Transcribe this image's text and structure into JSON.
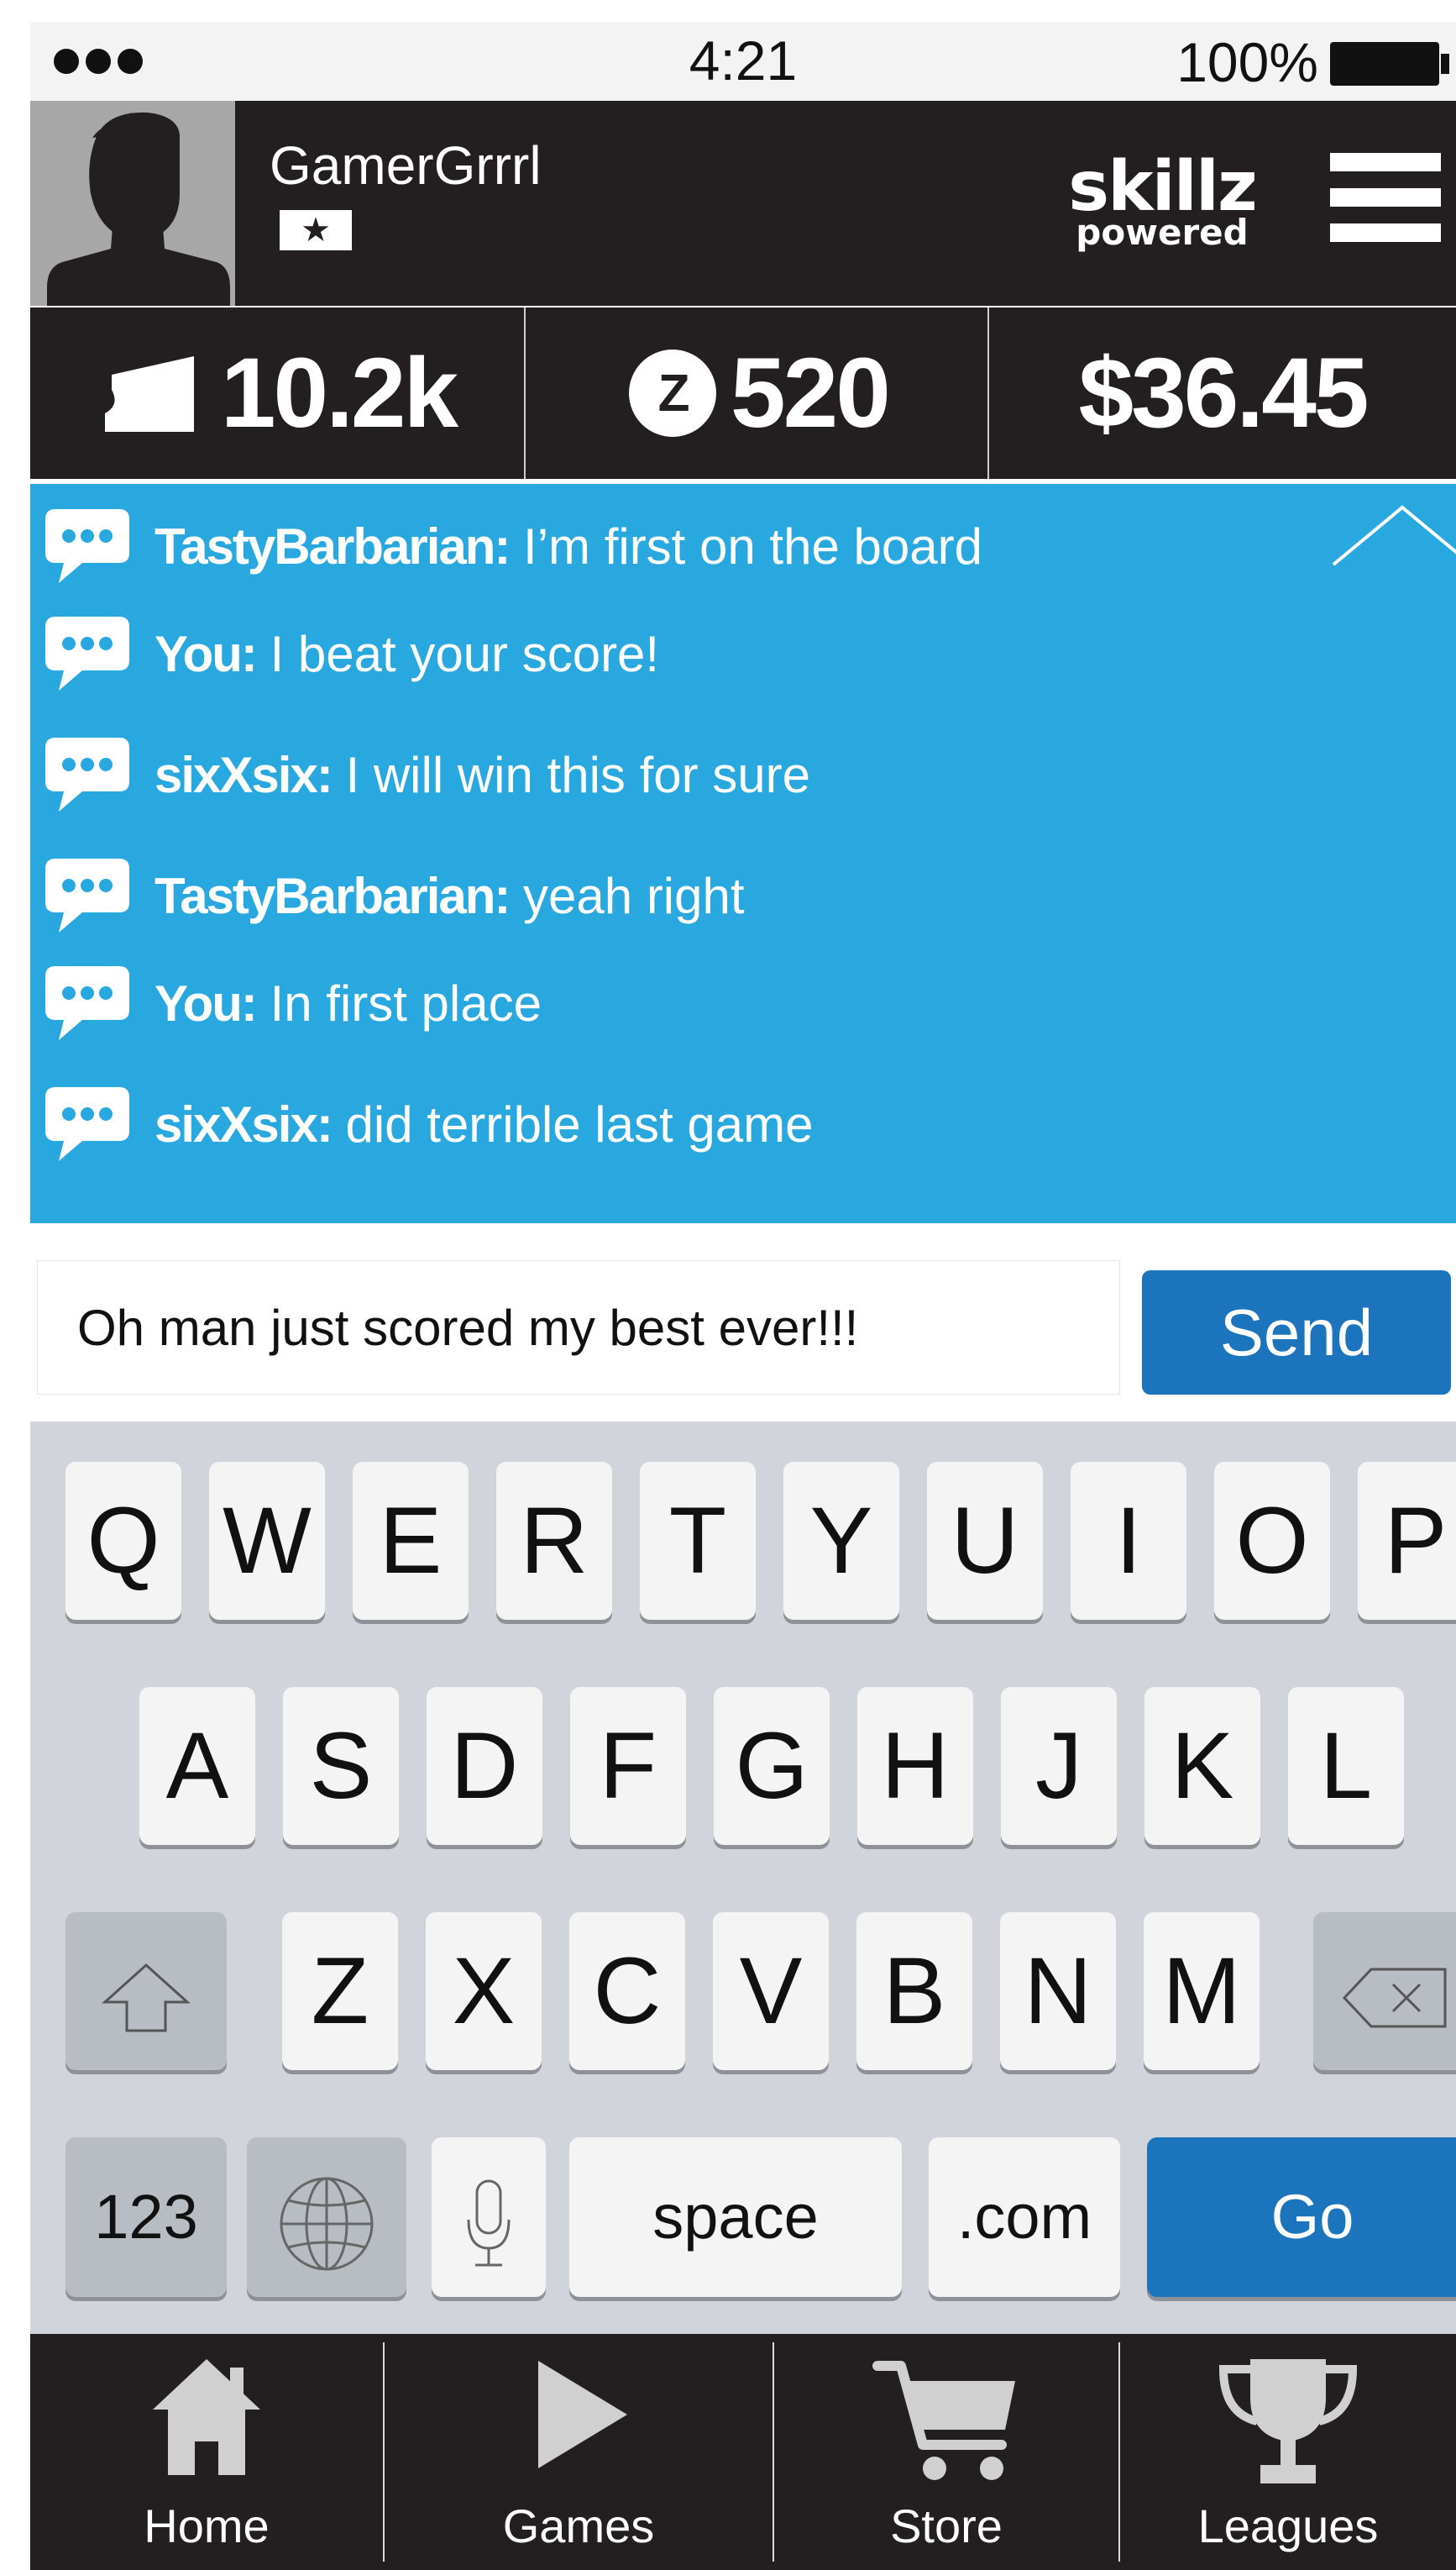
{
  "status_bar": {
    "time": "4:21",
    "battery_percent": "100%",
    "battery_level": 1.0
  },
  "profile": {
    "username": "GamerGrrrl",
    "rank_symbol": "★"
  },
  "brand": {
    "line1": "skillz",
    "line2": "powered"
  },
  "stats": [
    {
      "icon": "ticket-icon",
      "value": "10.2k"
    },
    {
      "icon": "z-coin-icon",
      "coin_letter": "Z",
      "value": "520"
    },
    {
      "icon": "none",
      "value": "$36.45"
    }
  ],
  "chat": {
    "messages": [
      {
        "sender": "TastyBarbarian:",
        "text": " I’m first on the board"
      },
      {
        "sender": "You:",
        "text": " I beat your score!"
      },
      {
        "sender": "sixXsix:",
        "text": " I will win this for sure"
      },
      {
        "sender": "TastyBarbarian:",
        "text": " yeah right"
      },
      {
        "sender": "You:",
        "text": "  In first place"
      },
      {
        "sender": "sixXsix:",
        "text": " did terrible last game"
      }
    ]
  },
  "composer": {
    "input_value": "Oh man just scored my best ever!!!",
    "send_label": "Send"
  },
  "keyboard": {
    "row1": [
      "Q",
      "W",
      "E",
      "R",
      "T",
      "Y",
      "U",
      "I",
      "O",
      "P"
    ],
    "row2": [
      "A",
      "S",
      "D",
      "F",
      "G",
      "H",
      "J",
      "K",
      "L"
    ],
    "row3": [
      "Z",
      "X",
      "C",
      "V",
      "B",
      "N",
      "M"
    ],
    "numbers_label": "123",
    "space_label": "space",
    "dotcom_label": ".com",
    "go_label": "Go"
  },
  "tabs": [
    {
      "icon": "home-icon",
      "label": "Home"
    },
    {
      "icon": "play-icon",
      "label": "Games"
    },
    {
      "icon": "cart-icon",
      "label": "Store"
    },
    {
      "icon": "trophy-icon",
      "label": "Leagues"
    }
  ],
  "colors": {
    "chat_background": "#29a8e0",
    "header_background": "#231f20",
    "accent_blue": "#1c75bc",
    "keyboard_background": "#d1d5db"
  }
}
